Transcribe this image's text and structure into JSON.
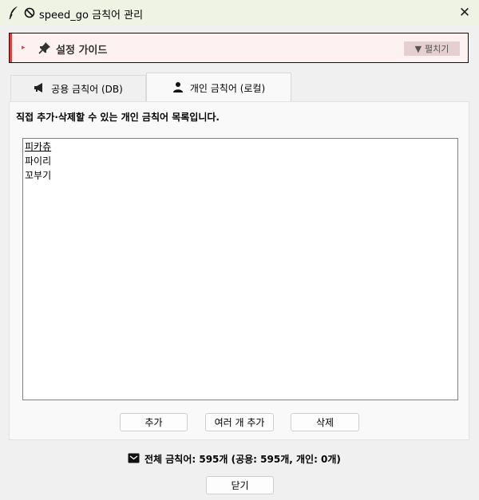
{
  "window": {
    "title": "speed_go 금칙어 관리",
    "close_symbol": "✕"
  },
  "guide": {
    "arrow_symbol": "▸",
    "title": "설정 가이드",
    "toggle_arrow": "▼",
    "toggle_label": "펼치기",
    "accent_color": "#d9413f"
  },
  "tabs": [
    {
      "label": "공용 금칙어 (DB)",
      "icon": "megaphone-icon",
      "selected": false
    },
    {
      "label": "개인 금칙어 (로컬)",
      "icon": "person-icon",
      "selected": true
    }
  ],
  "panel": {
    "description": "직접 추가·삭제할 수 있는 개인 금칙어 목록입니다.",
    "items": [
      "피카츄",
      "파이리",
      "꼬부기"
    ]
  },
  "buttons": {
    "add": "추가",
    "add_multiple": "여러 개 추가",
    "delete": "삭제",
    "close": "닫기"
  },
  "status": {
    "icon": "inbox-icon",
    "text": "전체 금칙어: 595개 (공용: 595개, 개인: 0개)"
  }
}
